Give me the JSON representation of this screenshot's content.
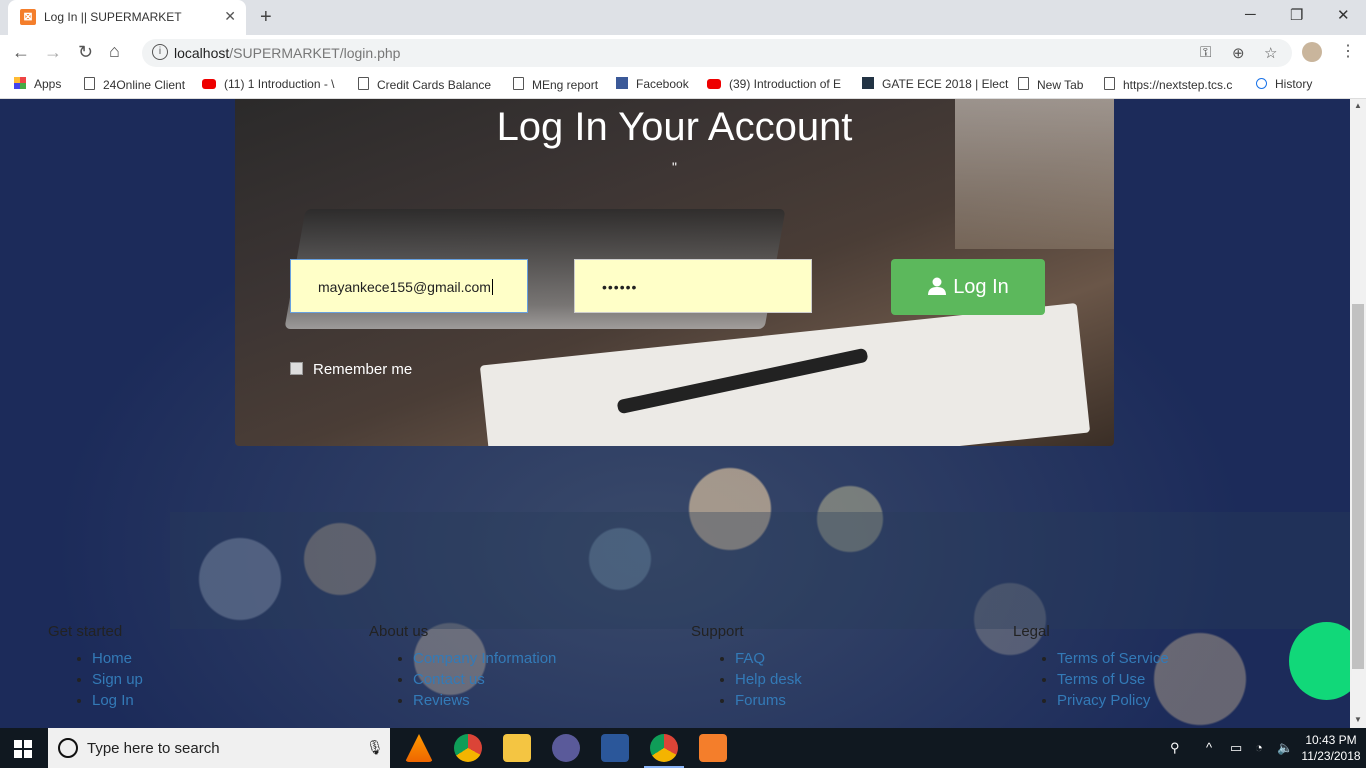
{
  "browser": {
    "tab_title": "Log In || SUPERMARKET",
    "url_host": "localhost",
    "url_path": "/SUPERMARKET/login.php",
    "bookmarks": [
      {
        "label": "Apps",
        "icon": "apps-grid-icon"
      },
      {
        "label": "24Online Client",
        "icon": "page-icon"
      },
      {
        "label": "(11) 1 Introduction - \\",
        "icon": "youtube-icon"
      },
      {
        "label": "Credit Cards Balance",
        "icon": "page-icon"
      },
      {
        "label": "MEng report",
        "icon": "page-icon"
      },
      {
        "label": "Facebook",
        "icon": "facebook-icon"
      },
      {
        "label": "(39) Introduction of E",
        "icon": "youtube-icon"
      },
      {
        "label": "GATE ECE 2018 | Elect",
        "icon": "gate-icon"
      },
      {
        "label": "New Tab",
        "icon": "page-icon"
      },
      {
        "label": "https://nextstep.tcs.c",
        "icon": "page-icon"
      },
      {
        "label": "History",
        "icon": "history-icon"
      }
    ]
  },
  "login": {
    "title": "Log In Your Account",
    "subtitle": "\"",
    "email_value": "mayankece155@gmail.com",
    "password_value": "••••••",
    "button_label": "Log In",
    "remember_label": "Remember me"
  },
  "footer": {
    "columns": [
      {
        "heading": "Get started",
        "links": [
          "Home",
          "Sign up",
          "Log In"
        ]
      },
      {
        "heading": "About us",
        "links": [
          "Company Information",
          "Contact us",
          "Reviews"
        ]
      },
      {
        "heading": "Support",
        "links": [
          "FAQ",
          "Help desk",
          "Forums"
        ]
      },
      {
        "heading": "Legal",
        "links": [
          "Terms of Service",
          "Terms of Use",
          "Privacy Policy"
        ]
      }
    ]
  },
  "taskbar": {
    "search_placeholder": "Type here to search",
    "time": "10:43 PM",
    "date": "11/23/2018"
  },
  "colors": {
    "login_button": "#5cb85c",
    "input_bg": "#ffffc8",
    "link": "#337ab7",
    "accent_circle": "#11d879"
  }
}
